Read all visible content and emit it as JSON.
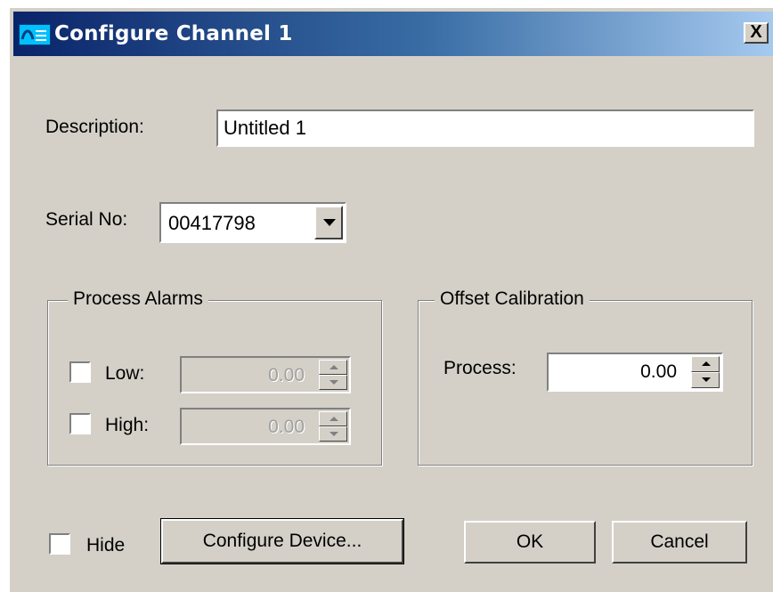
{
  "window": {
    "title": "Configure Channel 1",
    "close_label": "X"
  },
  "description": {
    "label": "Description:",
    "value": "Untitled 1"
  },
  "serial": {
    "label": "Serial No:",
    "value": "00417798"
  },
  "process_alarms": {
    "title": "Process Alarms",
    "low": {
      "label": "Low:",
      "checked": false,
      "value": "0.00"
    },
    "high": {
      "label": "High:",
      "checked": false,
      "value": "0.00"
    }
  },
  "offset_calibration": {
    "title": "Offset Calibration",
    "process": {
      "label": "Process:",
      "value": "0.00"
    }
  },
  "footer": {
    "hide_label": "Hide",
    "hide_checked": false,
    "configure_device_label": "Configure Device...",
    "ok_label": "OK",
    "cancel_label": "Cancel"
  },
  "colors": {
    "face": "#d4d0c8",
    "title_gradient_start": "#0a246a",
    "title_gradient_end": "#a6caf0"
  },
  "icons": {
    "app": "app-icon",
    "close": "close-icon",
    "dropdown": "chevron-down-icon",
    "spin_up": "spin-up-icon",
    "spin_down": "spin-down-icon"
  }
}
